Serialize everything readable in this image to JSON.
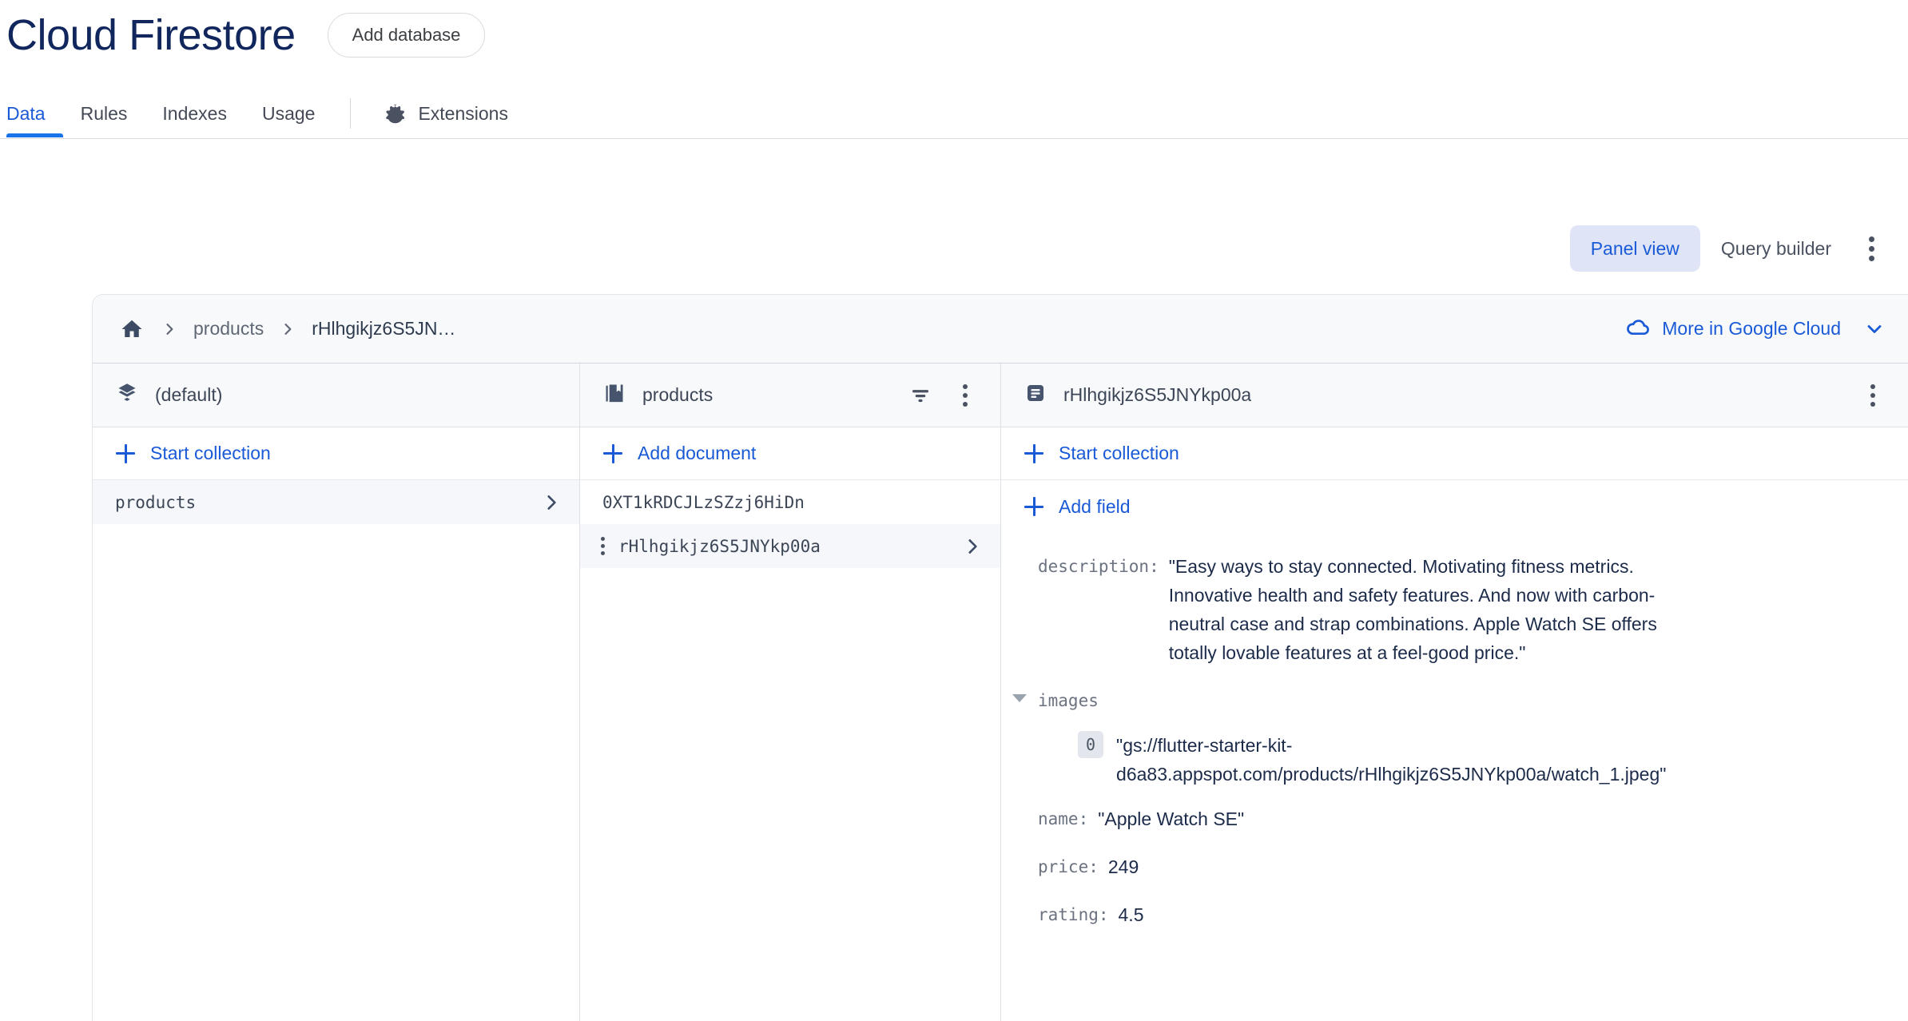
{
  "header": {
    "title": "Cloud Firestore",
    "add_database_label": "Add database",
    "tabs": [
      {
        "label": "Data",
        "active": true
      },
      {
        "label": "Rules",
        "active": false
      },
      {
        "label": "Indexes",
        "active": false
      },
      {
        "label": "Usage",
        "active": false
      },
      {
        "label": "Extensions",
        "active": false,
        "icon": "extensions-icon"
      }
    ]
  },
  "view_toggle": {
    "panel_view_label": "Panel view",
    "query_builder_label": "Query builder",
    "overflow_icon": "kebab-menu-icon",
    "active": "Panel view",
    "active_bg": "#dfe4f7",
    "active_fg": "#1a5ad7"
  },
  "breadcrumb": {
    "home_icon": "home-icon",
    "items": [
      {
        "label": "products",
        "current": false
      },
      {
        "label": "rHlhgikjz6S5JN…",
        "current": true
      }
    ],
    "more_in_google_cloud": "More in Google Cloud",
    "cloud_icon": "cloud-icon",
    "chevron_icon": "chevron-down-icon"
  },
  "panels": {
    "database": {
      "icon": "firestore-database-icon",
      "title": "(default)",
      "action_label": "Start collection",
      "items": [
        {
          "label": "products",
          "selected": true,
          "chevron": true
        }
      ]
    },
    "collection": {
      "icon": "collection-icon",
      "title": "products",
      "filter_icon": "filter-icon",
      "overflow_icon": "kebab-menu-icon",
      "action_label": "Add document",
      "items": [
        {
          "label": "0XT1kRDCJLzSZzj6HiDn",
          "selected": false,
          "chevron": false,
          "kebab": false
        },
        {
          "label": "rHlhgikjz6S5JNYkp00a",
          "selected": true,
          "chevron": true,
          "kebab": true
        }
      ]
    },
    "document": {
      "icon": "document-icon",
      "title": "rHlhgikjz6S5JNYkp00a",
      "overflow_icon": "kebab-menu-icon",
      "start_collection_label": "Start collection",
      "add_field_label": "Add field",
      "fields": [
        {
          "key": "description:",
          "value": "\"Easy ways to stay connected. Motivating fitness metrics. Innovative health and safety features. And now with carbon-neutral case and strap combinations. Apple Watch SE offers totally lovable features at a feel-good price.\"",
          "type": "string"
        },
        {
          "key": "images",
          "type": "array",
          "expanded": true,
          "items": [
            {
              "index": "0",
              "value": "\"gs://flutter-starter-kit-d6a83.appspot.com/products/rHlhgikjz6S5JNYkp00a/watch_1.jpeg\""
            }
          ]
        },
        {
          "key": "name:",
          "value": "\"Apple Watch SE\"",
          "type": "string"
        },
        {
          "key": "price:",
          "value": "249",
          "type": "number"
        },
        {
          "key": "rating:",
          "value": "4.5",
          "type": "number"
        }
      ]
    }
  },
  "colors": {
    "brand_blue": "#1a73e8",
    "link_blue": "#1a5ad7",
    "title_navy": "#10265c",
    "panel_header_bg": "#f7f9fb",
    "selected_row_bg": "#f5f7fa",
    "border": "#dde1e7"
  }
}
